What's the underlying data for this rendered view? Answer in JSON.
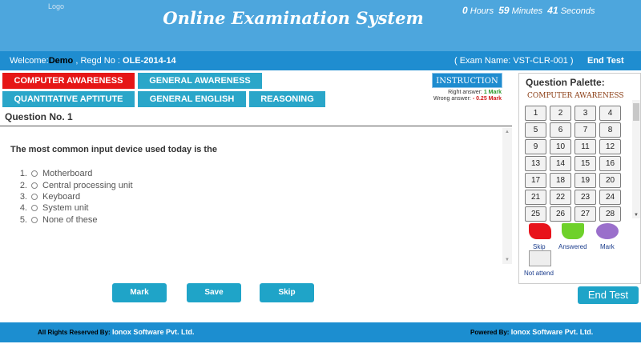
{
  "header": {
    "logo_alt": "Logo",
    "title": "Online Examination System",
    "timer": {
      "hours": "0",
      "hours_label": "Hours",
      "minutes": "59",
      "minutes_label": "Minutes",
      "seconds": "41",
      "seconds_label": "Seconds"
    }
  },
  "infobar": {
    "welcome_label": "Welcome:",
    "user": "Demo",
    "regd_label": ", Regd No :",
    "regd_no": "OLE-2014-14",
    "exam_name": "( Exam Name: VST-CLR-001 )",
    "end_test": "End Test"
  },
  "tabs": [
    {
      "label": "COMPUTER AWARENESS",
      "active": true
    },
    {
      "label": "GENERAL AWARENESS",
      "active": false
    },
    {
      "label": "QUANTITATIVE APTITUTE",
      "active": false
    },
    {
      "label": "GENERAL ENGLISH",
      "active": false
    },
    {
      "label": "REASONING",
      "active": false
    }
  ],
  "instruction": {
    "button": "INSTRUCTION",
    "right_label": "Right answer:",
    "right_value": "1 Mark",
    "wrong_label": "Wrong answer:",
    "wrong_value": "- 0.25 Mark"
  },
  "question": {
    "number_label": "Question No. 1",
    "text": "The most common input device used today is the",
    "options": [
      {
        "num": "1.",
        "label": "Motherboard"
      },
      {
        "num": "2.",
        "label": "Central processing unit"
      },
      {
        "num": "3.",
        "label": "Keyboard"
      },
      {
        "num": "4.",
        "label": "System unit"
      },
      {
        "num": "5.",
        "label": "None of these"
      }
    ]
  },
  "actions": {
    "mark": "Mark",
    "save": "Save",
    "skip": "Skip"
  },
  "palette": {
    "title": "Question Palette:",
    "section": "COMPUTER AWARENESS",
    "numbers": [
      "1",
      "2",
      "3",
      "4",
      "5",
      "6",
      "7",
      "8",
      "9",
      "10",
      "11",
      "12",
      "13",
      "14",
      "15",
      "16",
      "17",
      "18",
      "19",
      "20",
      "21",
      "22",
      "23",
      "24",
      "25",
      "26",
      "27",
      "28"
    ]
  },
  "legend": {
    "skip": "Skip",
    "answered": "Answered",
    "mark": "Mark",
    "not_attend": "Not attend",
    "colors": {
      "skip": "#e8131b",
      "answered": "#6ed12a",
      "mark": "#9a6fcb",
      "not_attend": "#eeeeee"
    }
  },
  "end_test_button": "End Test",
  "footer": {
    "left_label": "All Rights Reserved By:",
    "left_company": "Ionox Software Pvt. Ltd.",
    "right_label": "Powered By:",
    "right_company": "Ionox Software Pvt. Ltd."
  }
}
